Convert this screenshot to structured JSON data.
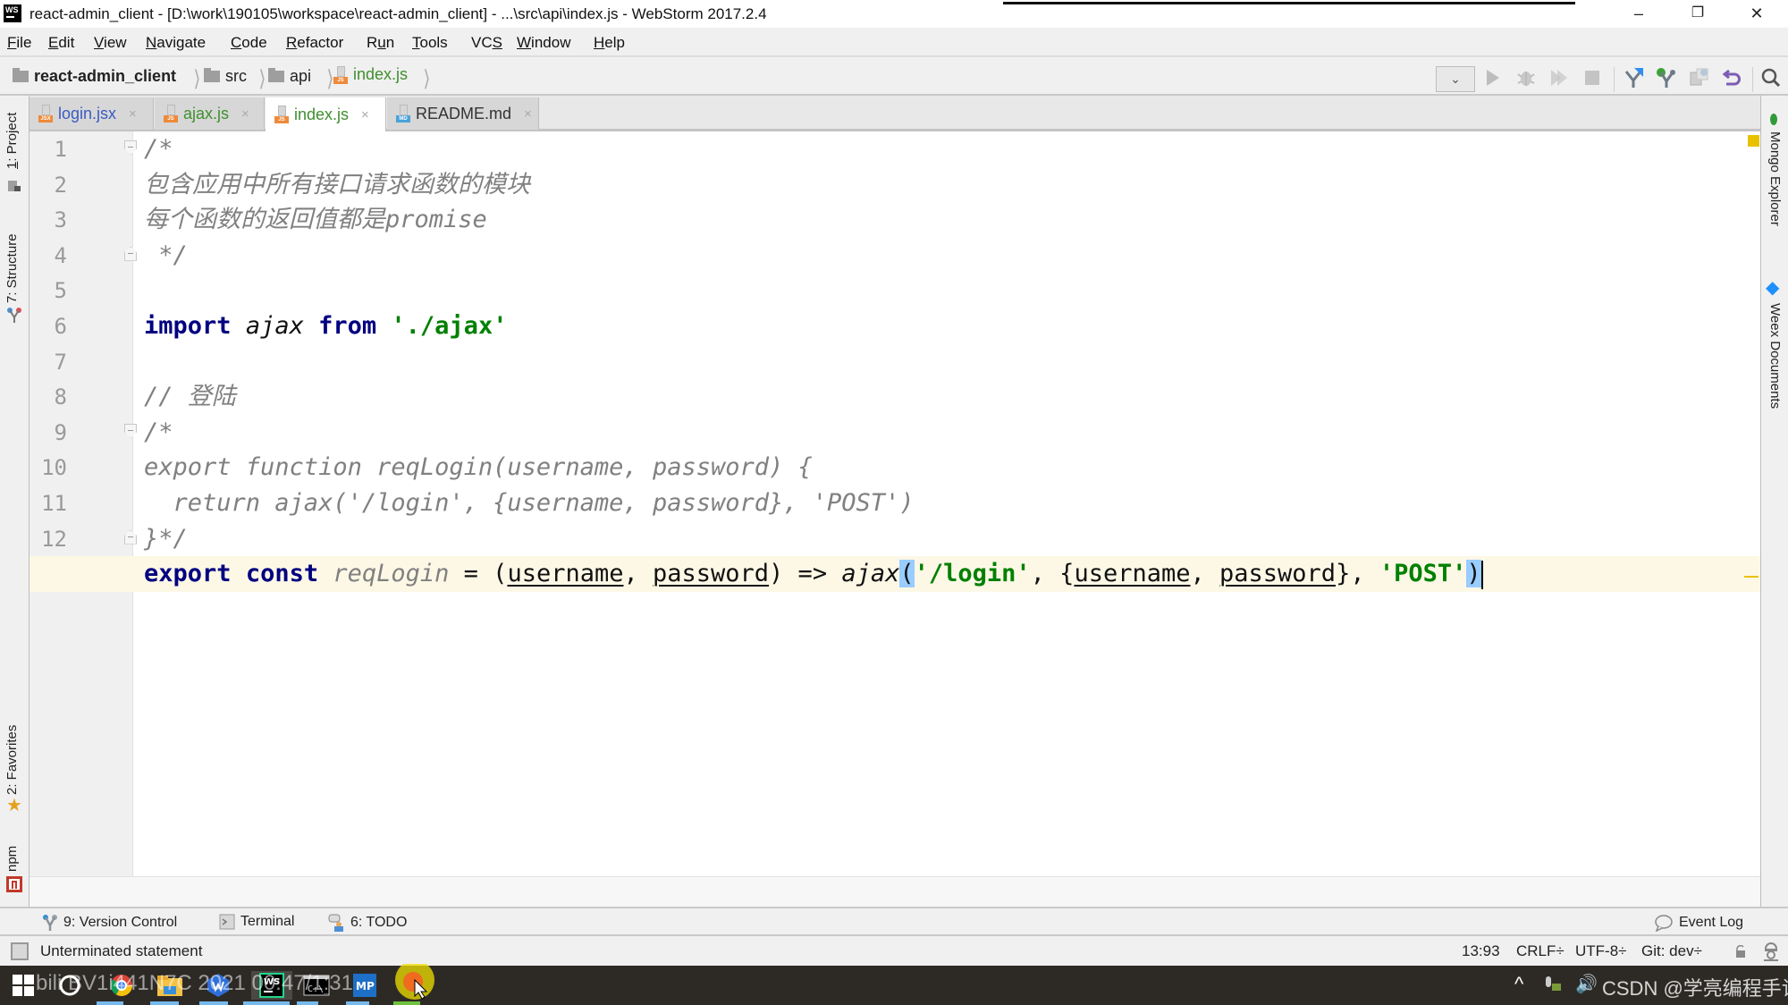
{
  "window": {
    "app_icon_label": "WS",
    "title": "react-admin_client - [D:\\work\\190105\\workspace\\react-admin_client] - ...\\src\\api\\index.js - WebStorm 2017.2.4",
    "minimize": "–",
    "restore": "❐",
    "close": "✕"
  },
  "menu": [
    {
      "label": "File",
      "mnemonic": "F",
      "rest": "ile"
    },
    {
      "label": "Edit",
      "mnemonic": "E",
      "rest": "dit"
    },
    {
      "label": "View",
      "mnemonic": "V",
      "rest": "iew"
    },
    {
      "label": "Navigate",
      "mnemonic": "N",
      "rest": "avigate"
    },
    {
      "label": "Code",
      "mnemonic": "C",
      "rest": "ode"
    },
    {
      "label": "Refactor",
      "mnemonic": "R",
      "rest": "efactor"
    },
    {
      "label": "Run",
      "pre": "R",
      "mnemonic": "u",
      "rest": "n"
    },
    {
      "label": "Tools",
      "mnemonic": "T",
      "rest": "ools"
    },
    {
      "label": "VCS",
      "pre": "VC",
      "mnemonic": "S",
      "rest": ""
    },
    {
      "label": "Window",
      "mnemonic": "W",
      "rest": "indow"
    },
    {
      "label": "Help",
      "mnemonic": "H",
      "rest": "elp"
    }
  ],
  "breadcrumb": [
    {
      "label": "react-admin_client",
      "type": "folder"
    },
    {
      "label": "src",
      "type": "folder"
    },
    {
      "label": "api",
      "type": "folder"
    },
    {
      "label": "index.js",
      "type": "js-file"
    }
  ],
  "toolbar": {
    "run_config_dropdown": "⌄",
    "icons": [
      "run-icon",
      "debug-icon",
      "coverage-icon",
      "stop-icon",
      "vcs-update-icon",
      "vcs-commit-icon",
      "vcs-compare-icon",
      "vcs-revert-icon",
      "search-everywhere-icon"
    ]
  },
  "tabs": [
    {
      "label": "login.jsx",
      "icon_tag": "JSX",
      "color": "#3c5bc2",
      "active": false
    },
    {
      "label": "ajax.js",
      "icon_tag": "JS",
      "color": "#3f8f2f",
      "active": false
    },
    {
      "label": "index.js",
      "icon_tag": "JS",
      "color": "#3f8f2f",
      "active": true
    },
    {
      "label": "README.md",
      "icon_tag": "MD",
      "color": "#333333",
      "active": false
    }
  ],
  "tab_close": "×",
  "left_tools": [
    {
      "label": "1: Project"
    },
    {
      "label": "7: Structure"
    },
    {
      "label": "2: Favorites"
    },
    {
      "label": "npm"
    }
  ],
  "right_tools": [
    {
      "label": "Mongo Explorer"
    },
    {
      "label": "Weex Documents"
    }
  ],
  "editor": {
    "current_line": 13,
    "lines": [
      {
        "n": "1",
        "segments": [
          {
            "t": "/*",
            "c": "cm"
          }
        ]
      },
      {
        "n": "2",
        "segments": [
          {
            "t": "包含应用中所有接口请求函数的模块",
            "c": "cm"
          }
        ]
      },
      {
        "n": "3",
        "segments": [
          {
            "t": "每个函数的返回值都是promise",
            "c": "cm"
          }
        ]
      },
      {
        "n": "4",
        "segments": [
          {
            "t": " */",
            "c": "cm"
          }
        ]
      },
      {
        "n": "5",
        "segments": []
      },
      {
        "n": "6",
        "segments": [
          {
            "t": "import",
            "c": "kw"
          },
          {
            "t": " ",
            "c": ""
          },
          {
            "t": "ajax",
            "c": "it"
          },
          {
            "t": " ",
            "c": ""
          },
          {
            "t": "from",
            "c": "kw"
          },
          {
            "t": " ",
            "c": ""
          },
          {
            "t": "'./ajax'",
            "c": "str"
          }
        ]
      },
      {
        "n": "7",
        "segments": []
      },
      {
        "n": "8",
        "segments": [
          {
            "t": "// 登陆",
            "c": "cm"
          }
        ]
      },
      {
        "n": "9",
        "segments": [
          {
            "t": "/*",
            "c": "cm"
          }
        ]
      },
      {
        "n": "10",
        "segments": [
          {
            "t": "export function reqLogin(username, password) {",
            "c": "cm"
          }
        ]
      },
      {
        "n": "11",
        "segments": [
          {
            "t": "  return ajax('/login', {username, password}, 'POST')",
            "c": "cm"
          }
        ]
      },
      {
        "n": "12",
        "segments": [
          {
            "t": "}*/",
            "c": "cm"
          }
        ]
      },
      {
        "n": "13",
        "segments": [
          {
            "t": "export",
            "c": "kw"
          },
          {
            "t": " ",
            "c": ""
          },
          {
            "t": "const",
            "c": "kw"
          },
          {
            "t": " ",
            "c": ""
          },
          {
            "t": "reqLogin",
            "c": "gray-it"
          },
          {
            "t": " = (",
            "c": ""
          },
          {
            "t": "username",
            "c": "ul"
          },
          {
            "t": ", ",
            "c": ""
          },
          {
            "t": "password",
            "c": "ul"
          },
          {
            "t": ") => ",
            "c": ""
          },
          {
            "t": "ajax",
            "c": "it"
          },
          {
            "t": "(",
            "c": "brace-hl"
          },
          {
            "t": "'/login'",
            "c": "str"
          },
          {
            "t": ", {",
            "c": ""
          },
          {
            "t": "username",
            "c": "ul"
          },
          {
            "t": ", ",
            "c": ""
          },
          {
            "t": "password",
            "c": "ul"
          },
          {
            "t": "}, ",
            "c": ""
          },
          {
            "t": "'POST'",
            "c": "str"
          },
          {
            "t": ")",
            "c": "brace-hl"
          }
        ]
      }
    ],
    "folds": [
      {
        "line": 1,
        "kind": "open"
      },
      {
        "line": 4,
        "kind": "close"
      },
      {
        "line": 9,
        "kind": "open"
      },
      {
        "line": 12,
        "kind": "close"
      }
    ]
  },
  "tool_windows": [
    {
      "label": "9: Version Control",
      "icon": "version-control-icon"
    },
    {
      "label": "Terminal",
      "icon": "terminal-icon"
    },
    {
      "label": "6: TODO",
      "icon": "todo-icon"
    }
  ],
  "event_log": "Event Log",
  "status": {
    "message": "Unterminated statement",
    "position": "13:93",
    "line_separator": "CRLF÷",
    "encoding": "UTF-8÷",
    "vcs_branch": "Git: dev÷"
  },
  "taskbar": {
    "apps": [
      "windows-start",
      "cortana",
      "chrome",
      "file-explorer",
      "app-blue",
      "webstorm",
      "cmd",
      "mp-app",
      "recorder"
    ],
    "watermark_left": "bili  BV1i441N7C  2021 00:47/1:31",
    "watermark_right": "CSDN @学亮编程手记"
  }
}
